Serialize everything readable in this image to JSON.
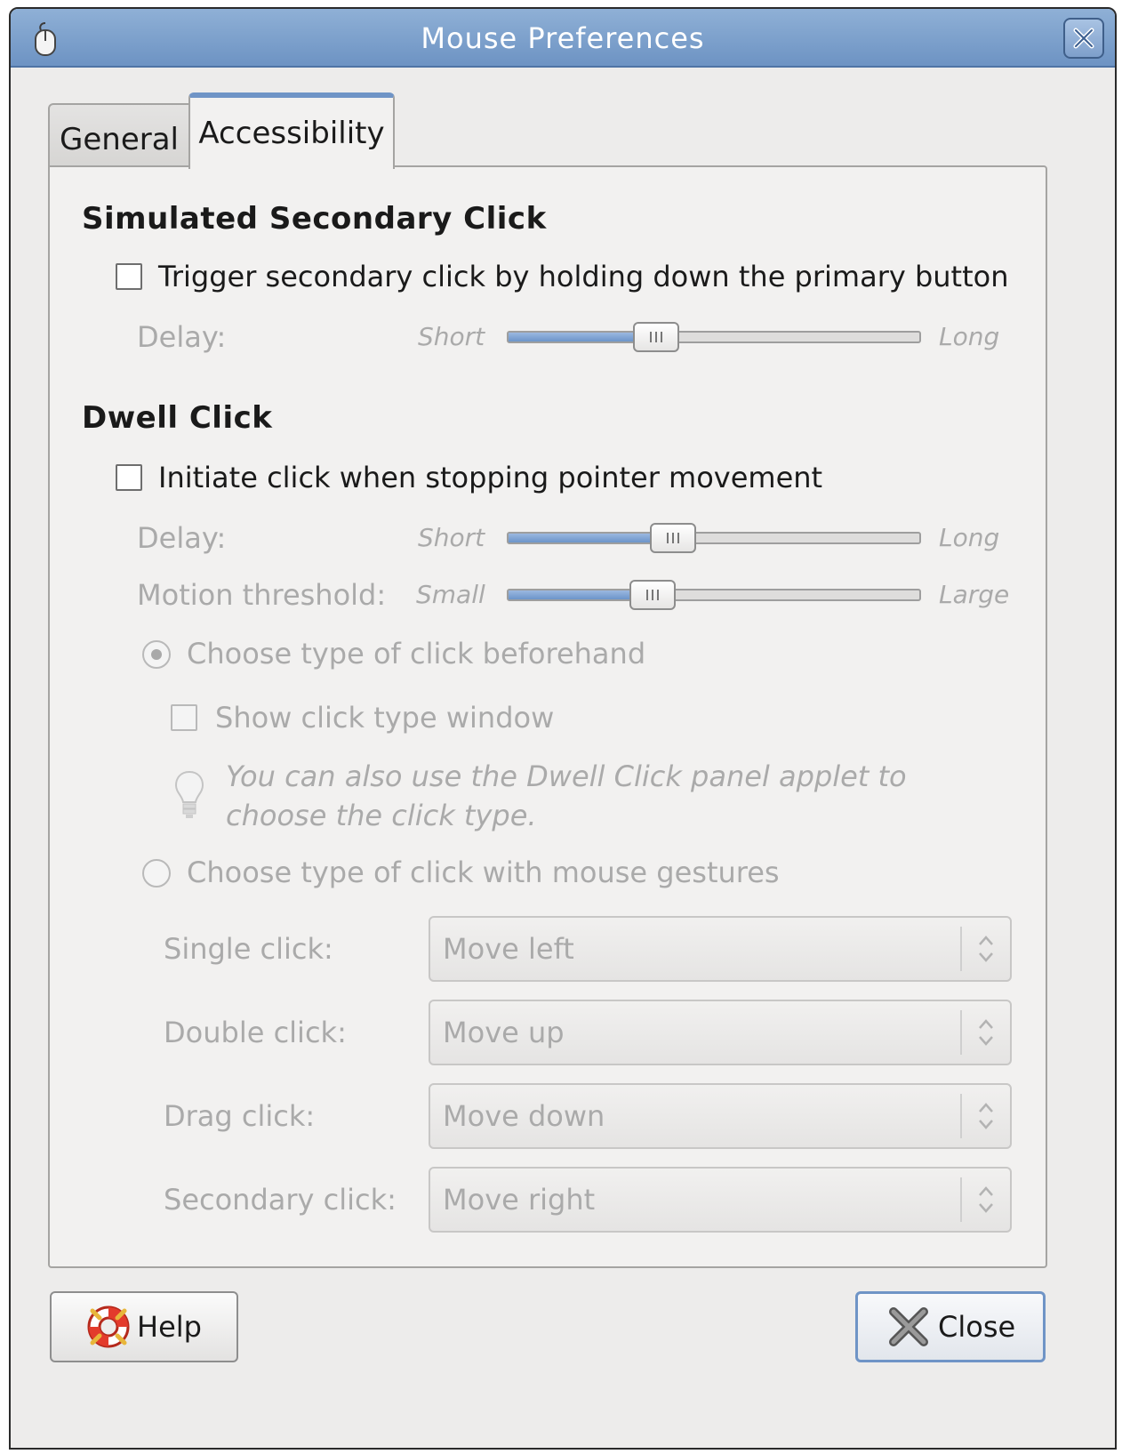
{
  "window": {
    "title": "Mouse Preferences"
  },
  "tabs": [
    {
      "label": "General",
      "selected": false
    },
    {
      "label": "Accessibility",
      "selected": true
    }
  ],
  "secondary_click": {
    "heading": "Simulated Secondary Click",
    "checkbox_label": "Trigger secondary click by holding down the primary button",
    "checked": false,
    "delay": {
      "label": "Delay:",
      "min_label": "Short",
      "max_label": "Long",
      "value": 0.36
    }
  },
  "dwell_click": {
    "heading": "Dwell Click",
    "checkbox_label": "Initiate click when stopping pointer movement",
    "checked": false,
    "delay": {
      "label": "Delay:",
      "min_label": "Short",
      "max_label": "Long",
      "value": 0.4
    },
    "motion_threshold": {
      "label": "Motion threshold:",
      "min_label": "Small",
      "max_label": "Large",
      "value": 0.35
    },
    "radio_beforehand": {
      "label": "Choose type of click beforehand",
      "selected": true
    },
    "show_click_window": {
      "label": "Show click type window",
      "checked": false
    },
    "hint_line1": "You can also use the Dwell Click panel applet to",
    "hint_line2": "choose the click type.",
    "radio_gestures": {
      "label": "Choose type of click with mouse gestures",
      "selected": false
    },
    "gestures": [
      {
        "label": "Single click:",
        "value": "Move left"
      },
      {
        "label": "Double click:",
        "value": "Move up"
      },
      {
        "label": "Drag click:",
        "value": "Move down"
      },
      {
        "label": "Secondary click:",
        "value": "Move right"
      }
    ]
  },
  "buttons": {
    "help": "Help",
    "close": "Close"
  }
}
